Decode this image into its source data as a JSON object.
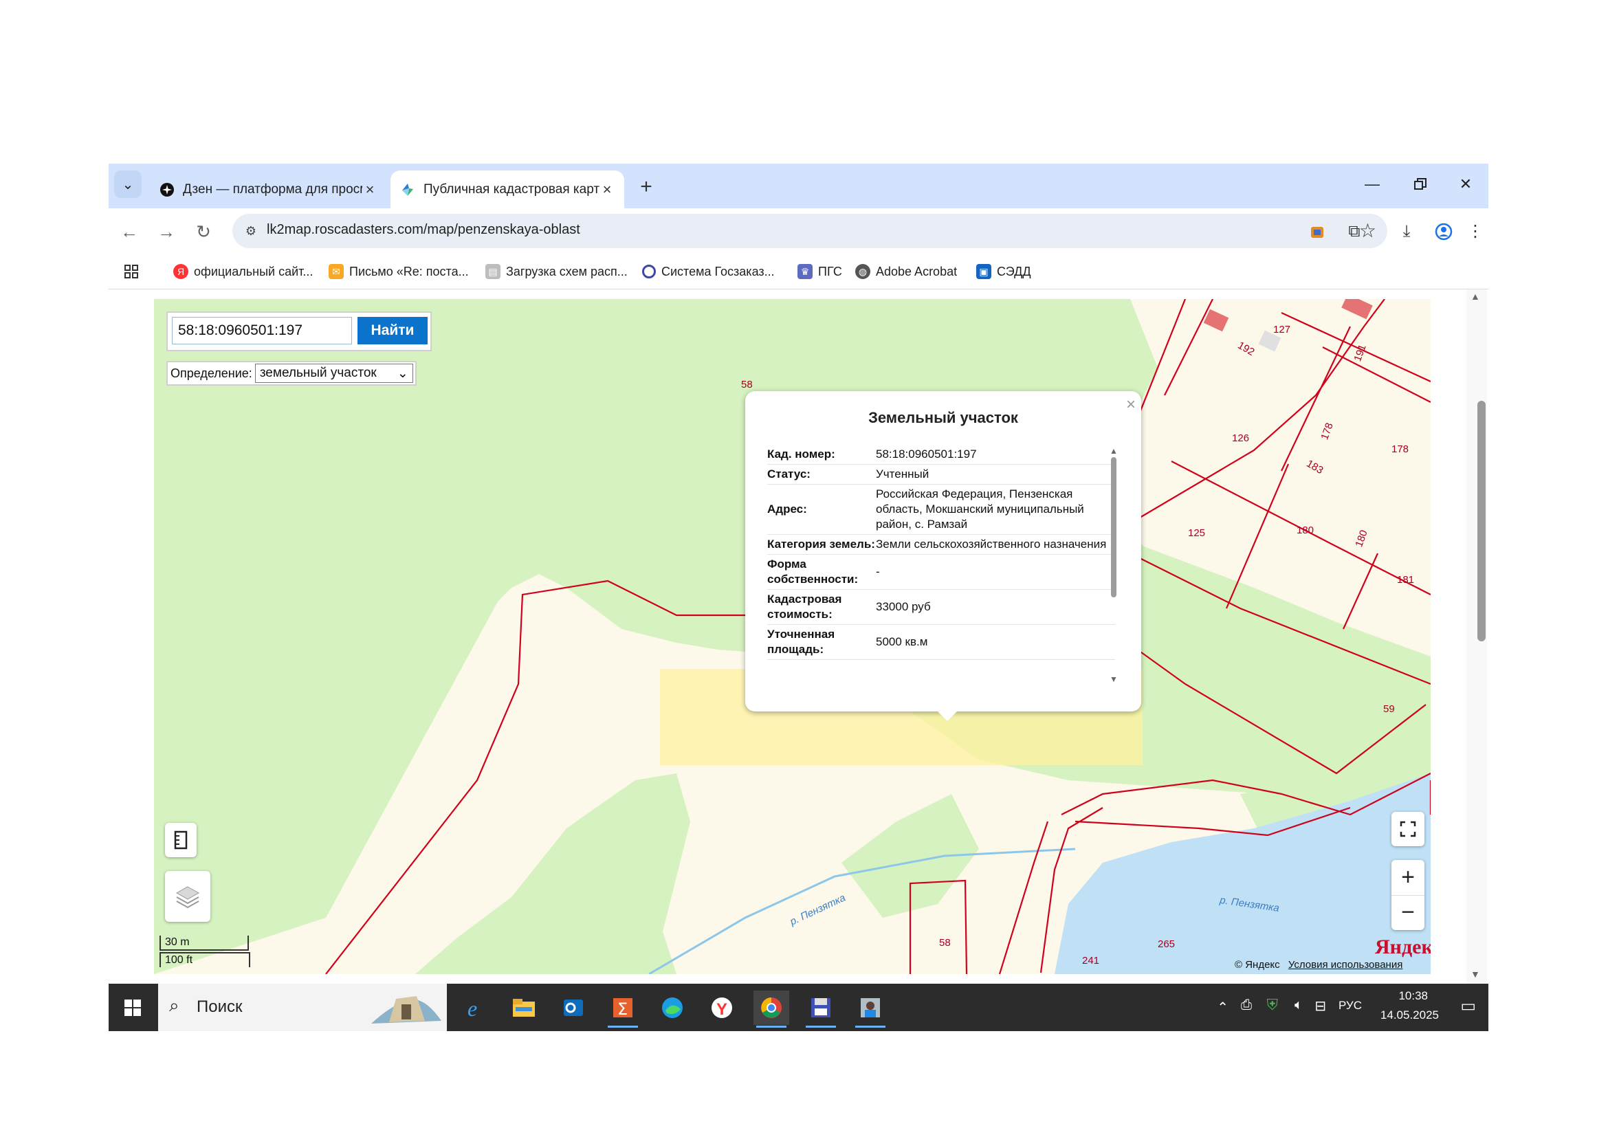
{
  "tabs": [
    {
      "title": "Дзен — платформа для просм",
      "icon": "dzen-icon",
      "active": false
    },
    {
      "title": "Публичная кадастровая карта",
      "icon": "roscadasters-icon",
      "active": true
    }
  ],
  "toolbar": {
    "url": "lk2map.roscadasters.com/map/penzenskaya-oblast"
  },
  "bookmarks": [
    {
      "label": "официальный сайт...",
      "icon": "yandex-icon",
      "color": "#f33"
    },
    {
      "label": "Письмо «Re: поста...",
      "icon": "mail-icon",
      "color": "#f9a825"
    },
    {
      "label": "Загрузка схем расп...",
      "icon": "document-icon",
      "color": "#9e9e9e"
    },
    {
      "label": "Система Госзаказ...",
      "icon": "gov-order-icon",
      "color": "#3949ab"
    },
    {
      "label": "ПГС",
      "icon": "emblem-icon",
      "color": "#5c6bc0"
    },
    {
      "label": "Adobe Acrobat",
      "icon": "globe-icon",
      "color": "#555555"
    },
    {
      "label": "СЭДД",
      "icon": "sedd-icon",
      "color": "#1565c0"
    }
  ],
  "search": {
    "value": "58:18:0960501:197",
    "button_label": "Найти"
  },
  "definition": {
    "label": "Определение:",
    "selected": "земельный участок"
  },
  "popup": {
    "title": "Земельный участок",
    "rows": [
      {
        "key": "Кад. номер:",
        "value": "58:18:0960501:197"
      },
      {
        "key": "Статус:",
        "value": "Учтенный"
      },
      {
        "key": "Адрес:",
        "value": "Российская Федерация, Пензенская область, Мокшанский муниципальный район, с. Рамзай"
      },
      {
        "key": "Категория земель:",
        "value": "Земли сельскохозяйственного назначения"
      },
      {
        "key": "Форма собственности:",
        "value": "-"
      },
      {
        "key": "Кадастровая стоимость:",
        "value": "33000 руб"
      },
      {
        "key": "Уточненная площадь:",
        "value": "5000 кв.м"
      }
    ]
  },
  "map": {
    "parcel_labels": [
      "127",
      "192",
      "191",
      "126",
      "178",
      "178",
      "183",
      "125",
      "180",
      "180",
      "181",
      "59",
      "58",
      "241",
      "265",
      "58"
    ],
    "river_labels": [
      "р. Пензятка",
      "р. Пензятка"
    ],
    "scale": {
      "metric": "30 m",
      "imperial": "100 ft"
    },
    "logo": "Яндекс",
    "attribution": "© Яндекс",
    "terms": "Условия использования",
    "colors": {
      "forest": "#d6f2c0",
      "field": "#fcf8ea",
      "water": "#bfe0f5",
      "parcel_border": "#d0021b",
      "highlight": "#fff2a0"
    }
  },
  "taskbar": {
    "search_label": "Поиск",
    "language": "РУС",
    "time": "10:38",
    "date": "14.05.2025"
  }
}
